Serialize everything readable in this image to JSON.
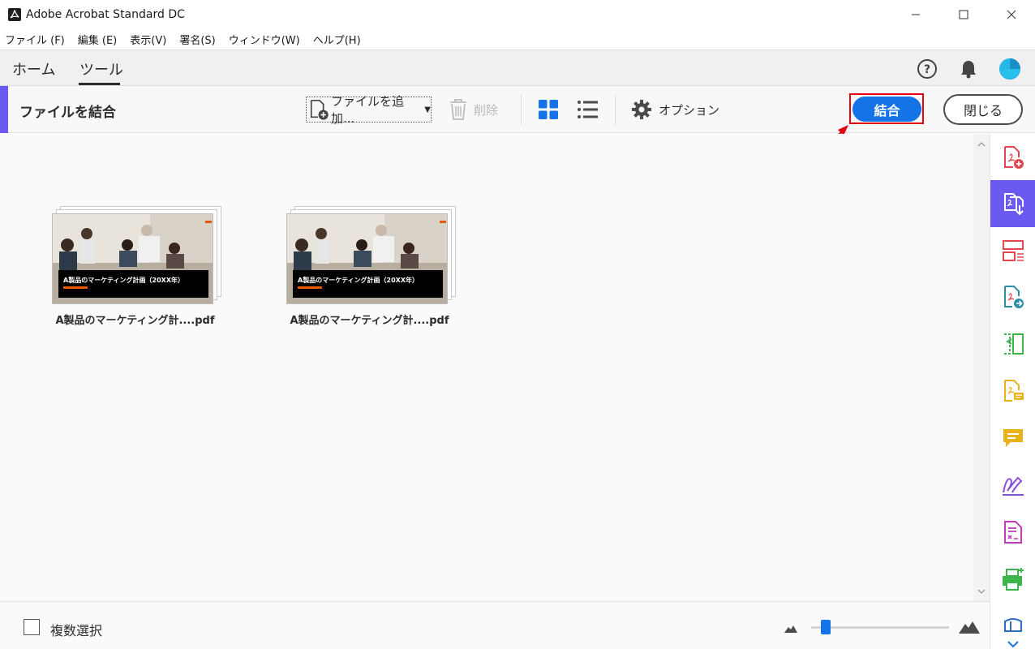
{
  "window": {
    "title": "Adobe Acrobat Standard DC",
    "controls": [
      "minimize",
      "maximize",
      "close"
    ]
  },
  "menu": [
    "ファイル (F)",
    "編集 (E)",
    "表示(V)",
    "署名(S)",
    "ウィンドウ(W)",
    "ヘルプ(H)"
  ],
  "nav": {
    "tabs": [
      {
        "label": "ホーム",
        "active": false
      },
      {
        "label": "ツール",
        "active": true
      }
    ],
    "icons": [
      "help-icon",
      "bell-icon",
      "avatar"
    ]
  },
  "tool": {
    "title": "ファイルを結合",
    "add_files_label": "ファイルを追加...",
    "delete_label": "削除",
    "options_label": "オプション",
    "combine_label": "結合",
    "close_label": "閉じる",
    "accent_color": "#6a5af0",
    "primary_color": "#1473e6",
    "highlight_color": "#e60012"
  },
  "files": [
    {
      "name": "A製品のマーケティング計....pdf",
      "thumbnail_title": "A製品のマーケティング計画（20XX年）"
    },
    {
      "name": "A製品のマーケティング計....pdf",
      "thumbnail_title": "A製品のマーケティング計画（20XX年）"
    }
  ],
  "rail": {
    "items": [
      {
        "icon": "create-pdf-icon",
        "color": "#e34850",
        "active": false
      },
      {
        "icon": "combine-files-icon",
        "color": "#ffffff",
        "active": true
      },
      {
        "icon": "organize-pages-icon",
        "color": "#e34850",
        "active": false
      },
      {
        "icon": "export-pdf-icon",
        "color": "#2b8ea6",
        "active": false
      },
      {
        "icon": "edit-pdf-icon",
        "color": "#3db54a",
        "active": false
      },
      {
        "icon": "comment-file-icon",
        "color": "#e8b21a",
        "active": false
      },
      {
        "icon": "comment-icon",
        "color": "#e8b21a",
        "active": false
      },
      {
        "icon": "fill-sign-icon",
        "color": "#8a4fd8",
        "active": false
      },
      {
        "icon": "request-esign-icon",
        "color": "#c23ab8",
        "active": false
      },
      {
        "icon": "print-production-icon",
        "color": "#3db54a",
        "active": false
      },
      {
        "icon": "protect-icon",
        "color": "#2b6cc4",
        "active": false
      }
    ],
    "more_icon": "chevron-down-icon"
  },
  "footer": {
    "multi_select_label": "複数選択",
    "multi_select_checked": false,
    "zoom_level": 0.07
  }
}
